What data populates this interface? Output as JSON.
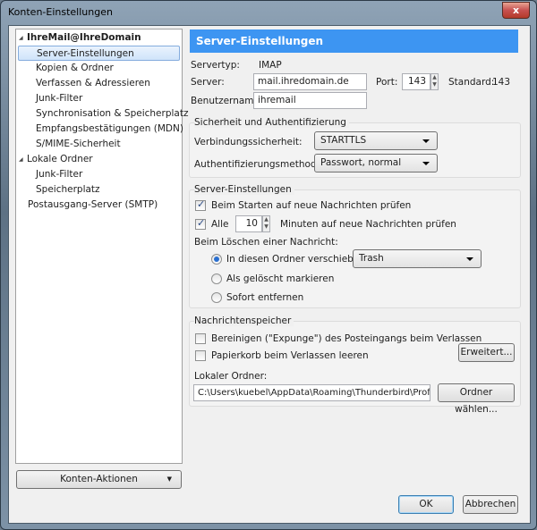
{
  "window": {
    "title": "Konten-Einstellungen",
    "close": "x"
  },
  "tree": {
    "items": [
      {
        "label": "IhreMail@IhreDomain",
        "level": 0,
        "expanded": true
      },
      {
        "label": "Server-Einstellungen",
        "level": 1,
        "selected": true
      },
      {
        "label": "Kopien & Ordner",
        "level": 1
      },
      {
        "label": "Verfassen & Adressieren",
        "level": 1
      },
      {
        "label": "Junk-Filter",
        "level": 1
      },
      {
        "label": "Synchronisation & Speicherplatz",
        "level": 1
      },
      {
        "label": "Empfangsbestätigungen (MDN)",
        "level": 1
      },
      {
        "label": "S/MIME-Sicherheit",
        "level": 1
      },
      {
        "label": "Lokale Ordner",
        "level": 0,
        "expanded": true
      },
      {
        "label": "Junk-Filter",
        "level": 1
      },
      {
        "label": "Speicherplatz",
        "level": 1
      },
      {
        "label": "Postausgang-Server (SMTP)",
        "level": 0
      }
    ]
  },
  "account_actions": "Konten-Aktionen",
  "header": "Server-Einstellungen",
  "server": {
    "type_label": "Servertyp:",
    "type_value": "IMAP",
    "server_label": "Server:",
    "server_value": "mail.ihredomain.de",
    "port_label": "Port:",
    "port_value": "143",
    "standard_label": "Standard:",
    "standard_value": "143",
    "user_label": "Benutzername:",
    "user_value": "ihremail"
  },
  "security": {
    "title": "Sicherheit und Authentifizierung",
    "conn_label": "Verbindungssicherheit:",
    "conn_value": "STARTTLS",
    "auth_label": "Authentifizierungsmethode:",
    "auth_value": "Passwort, normal"
  },
  "settings": {
    "title": "Server-Einstellungen",
    "check_start": "Beim Starten auf neue Nachrichten prüfen",
    "check_start_on": true,
    "every_label": "Alle",
    "every_on": true,
    "every_value": "10",
    "every_suffix": "Minuten auf neue Nachrichten prüfen",
    "delete_label": "Beim Löschen einer Nachricht:",
    "opt_move": "In diesen Ordner verschieben:",
    "opt_move_folder": "Trash",
    "opt_mark": "Als gelöscht markieren",
    "opt_remove": "Sofort entfernen",
    "selected": "move"
  },
  "storage": {
    "title": "Nachrichtenspeicher",
    "expunge": "Bereinigen (\"Expunge\") des Posteingangs beim Verlassen",
    "empty_trash": "Papierkorb beim Verlassen leeren",
    "advanced": "Erweitert...",
    "local_label": "Lokaler Ordner:",
    "local_value": "C:\\Users\\kuebel\\AppData\\Roaming\\Thunderbird\\Profiles\\",
    "choose": "Ordner wählen..."
  },
  "buttons": {
    "ok": "OK",
    "cancel": "Abbrechen"
  },
  "colors": {
    "header": "#3d95f2",
    "close": "#c75050"
  }
}
